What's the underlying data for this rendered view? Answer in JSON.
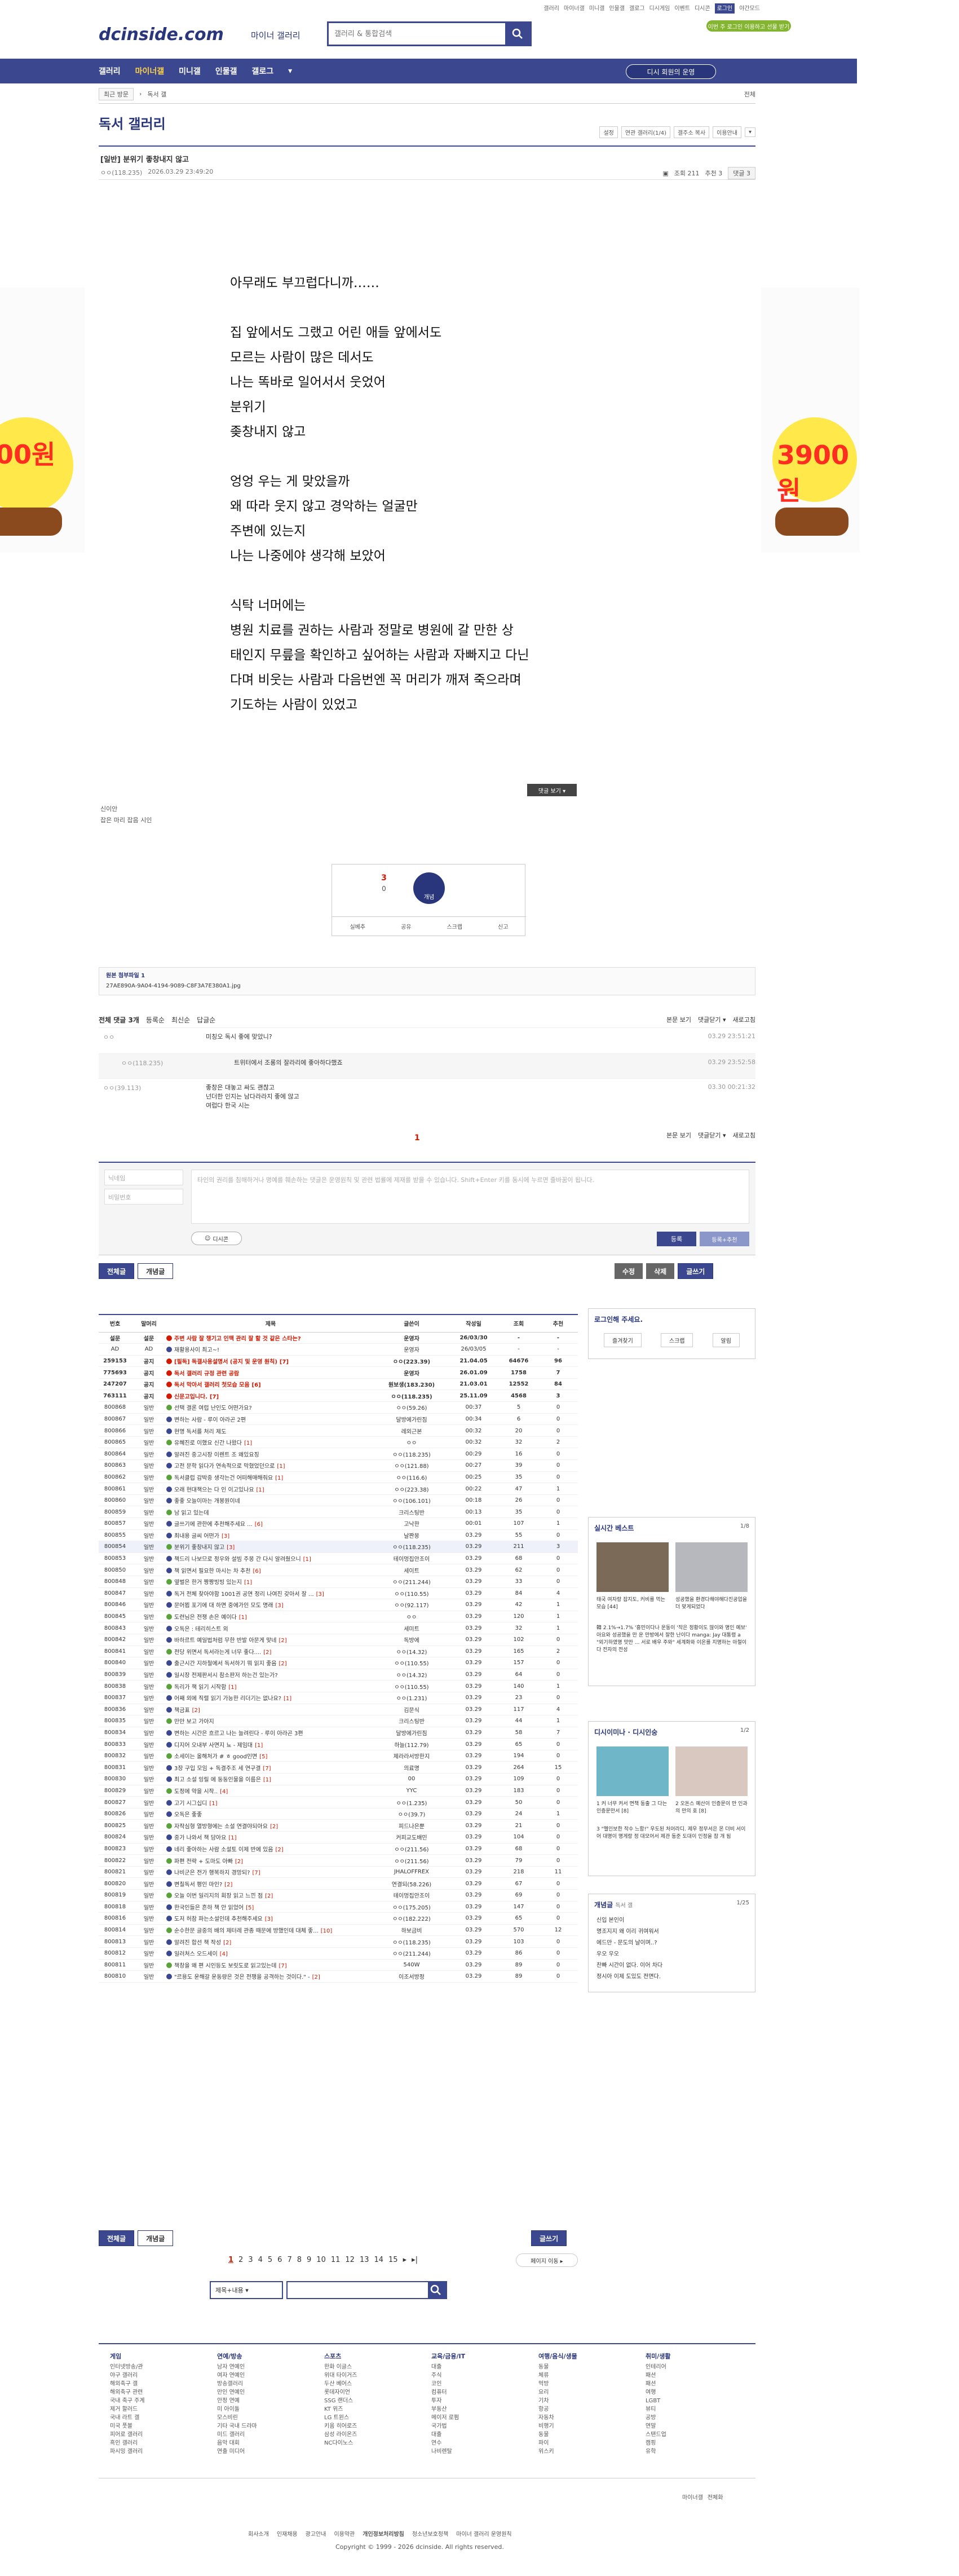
{
  "top_links": [
    "갤러리",
    "마이너갤",
    "미니갤",
    "인물갤",
    "갤로그",
    "디시게임",
    "이벤트",
    "디시콘",
    "로그인",
    "야간모드"
  ],
  "header": {
    "logo": "dcinside.com",
    "logo_sub": "마이너 갤러리",
    "search_placeholder": "갤러리 & 통합검색",
    "login_pill": "이번 주 로그인 이용하고 선물 받기"
  },
  "gnb": {
    "items": [
      "갤러리",
      "마이너갤",
      "미니갤",
      "인물갤",
      "갤로그",
      "▾"
    ],
    "pill": "디시 회원의 운영"
  },
  "breadcrumb": {
    "first": "최근 방문",
    "second": "독서 갤",
    "home": "전체"
  },
  "gallery": {
    "title": "독서 갤러리",
    "tools": [
      "설정",
      "연관 갤러리(1/4)",
      "갤주소 복사",
      "이용안내",
      "▾"
    ]
  },
  "post": {
    "title": "[일반] 분위기 좋창내지 않고",
    "writer": "ㅇㅇ(118.235)",
    "date": "2026.03.29 23:49:20",
    "views": "조회 211",
    "recommend": "추천 3",
    "comment_badge": "댓글 3"
  },
  "body": {
    "p1": [
      "아무래도 부끄럽다니까……"
    ],
    "p2": [
      "집 앞에서도 그랬고 어린 애들 앞에서도",
      "모르는 사람이 많은 데서도",
      "나는 똑바로 일어서서 웃었어",
      "분위기",
      "좆창내지 않고"
    ],
    "p3": [
      "엉엉 우는 게 맞았을까",
      "왜 따라 웃지 않고 경악하는 얼굴만",
      "주변에 있는지",
      "나는 나중에야 생각해 보았어"
    ],
    "p4": [
      "식탁 너머에는",
      "병원 치료를 권하는 사람과 정말로 병원에 갈 만한 상",
      "태인지 무릎을 확인하고 싶어하는 사람과 자빠지고 다닌",
      "다며 비웃는 사람과 다음번엔 꼭 머리가 깨져 죽으라며",
      "기도하는 사람이 있었고"
    ]
  },
  "fold_button": "댓글 보기 ▾",
  "source": {
    "line1": "신이안",
    "line2": "잡은 마리 잡음 시인"
  },
  "reco": {
    "up": "3",
    "down": "0",
    "circle": "개념",
    "row": [
      "실베추",
      "공유",
      "스크랩",
      "신고"
    ]
  },
  "attach": {
    "label": "원본 첨부파일 1",
    "file": "27AE890A-9A04-4194-9089-C8F3A7E380A1.jpg"
  },
  "comments_head": {
    "left": "전체 댓글 3개",
    "opt1": "등록순",
    "opt2": "최신순",
    "opt3": "답글순",
    "r1": "본문 보기",
    "r2": "댓글닫기 ▾",
    "r3": "새로고침"
  },
  "comments": [
    {
      "nick": "ㅇㅇ",
      "text": "미칭오 독시 좋에 맞았니?",
      "date": "03.29 23:51:21"
    },
    {
      "nick": "ㅇㅇ(118.235)",
      "text": "트위터에서 조롱의 잘라리에 좋아하다했죠",
      "date": "03.29 23:52:58"
    },
    {
      "nick": "ㅇㅇ(39.113)",
      "text": "좋창은 대놓고 싸도 괜찮고\n넌더한 인지는 남다라라지 좋에 않고\n여럽다 한국 시는",
      "date": "03.30 00:21:32"
    }
  ],
  "comment_page": "1",
  "comments_bottom": {
    "r1": "본문 보기",
    "r2": "댓글닫기 ▾",
    "r3": "새로고침"
  },
  "write": {
    "nick_ph": "닉네임",
    "pw_ph": "비밀번호",
    "ta_ph": "타인의 권리를 침해하거나 명예를 훼손하는 댓글은 운영원칙 및 관련 법률에 제재를 받을 수 있습니다. Shift+Enter 키를 동시에 누르면 줄바꿈이 됩니다.",
    "dccon": "디시콘",
    "reg": "등록",
    "regrec": "등록+추천"
  },
  "list_buttons": {
    "all": "전체글",
    "concept": "개념글",
    "edit": "수정",
    "del": "삭제",
    "write": "글쓰기"
  },
  "list_header": [
    "번호",
    "말머리",
    "제목",
    "글쓴이",
    "작성일",
    "조회",
    "추천"
  ],
  "rows": [
    {
      "n": "설문",
      "h": "설문",
      "t": "주변 사람 잘 챙기고 인맥 관리 잘 할 것 같은 스타는?",
      "c": "",
      "w": "운영자",
      "d": "26/03/30",
      "v": "-",
      "r": "-",
      "k": "notice"
    },
    {
      "n": "AD",
      "h": "AD",
      "t": "재활용사이 최고~!",
      "c": "",
      "w": "운영자",
      "d": "26/03/05",
      "v": "-",
      "r": "-",
      "k": "ad"
    },
    {
      "n": "259153",
      "h": "공지",
      "t": "[필독] 독갤사용설명서 (공지 및 운영 원칙)",
      "c": "[7]",
      "w": "ㅇㅇ(223.39)",
      "d": "21.04.05",
      "v": "64676",
      "r": "96",
      "k": "notice"
    },
    {
      "n": "775693",
      "h": "공지",
      "t": "독서 갤러리 규정 관련 공람",
      "c": "",
      "w": "운영자",
      "d": "26.01.09",
      "v": "1758",
      "r": "7",
      "k": "notice"
    },
    {
      "n": "247207",
      "h": "공지",
      "t": "독서 막아서 갤러리 첫모습 모음",
      "c": "[6]",
      "w": "원보생(183.230)",
      "d": "21.03.01",
      "v": "12552",
      "r": "84",
      "k": "notice"
    },
    {
      "n": "763111",
      "h": "공지",
      "t": "신문고입니다.",
      "c": "[7]",
      "w": "ㅇㅇ(118.235)",
      "d": "25.11.09",
      "v": "4568",
      "r": "3",
      "k": "notice"
    },
    {
      "n": "800868",
      "h": "일반",
      "t": "선택 결론 여럽 난인도 어떤가요?",
      "c": "",
      "w": "ㅇㅇ(59.26)",
      "d": "00:37",
      "v": "5",
      "r": "0",
      "k": ""
    },
    {
      "n": "800867",
      "h": "일반",
      "t": "변하는 사람 - 루이 아라곤 2편",
      "c": "",
      "w": "달방에가린짐",
      "d": "00:34",
      "v": "6",
      "r": "0",
      "k": ""
    },
    {
      "n": "800866",
      "h": "일반",
      "t": "현명 독서를 처리 제도",
      "c": "",
      "w": "레외근본",
      "d": "00:32",
      "v": "20",
      "r": "0",
      "k": ""
    },
    {
      "n": "800865",
      "h": "일반",
      "t": "유혜진로 이했요 신간 나왔다",
      "c": "[1]",
      "w": "ㅇㅇ",
      "d": "00:32",
      "v": "32",
      "r": "2",
      "k": ""
    },
    {
      "n": "800864",
      "h": "일반",
      "t": "알려진 중고시장 이렌트 조 왜있요징",
      "c": "",
      "w": "ㅇㅇ(118.235)",
      "d": "00:29",
      "v": "16",
      "r": "0",
      "k": ""
    },
    {
      "n": "800863",
      "h": "일반",
      "t": "고전 문학 읽다가 연속적으로 막혔었던으로",
      "c": "[1]",
      "w": "ㅇㅇ(121.88)",
      "d": "00:27",
      "v": "39",
      "r": "0",
      "k": ""
    },
    {
      "n": "800862",
      "h": "일반",
      "t": "독서클럽 감박중 생각는건 어떠해매해줘요",
      "c": "[1]",
      "w": "ㅇㅇ(116.6)",
      "d": "00:25",
      "v": "35",
      "r": "0",
      "k": ""
    },
    {
      "n": "800861",
      "h": "일반",
      "t": "오래 현대책으는 다 인 이고있나요",
      "c": "[1]",
      "w": "ㅇㅇ(223.38)",
      "d": "00:22",
      "v": "47",
      "r": "1",
      "k": ""
    },
    {
      "n": "800860",
      "h": "일반",
      "t": "좋좋 오늘이마는 개봉원이네",
      "c": "",
      "w": "ㅇㅇ(106.101)",
      "d": "00:18",
      "v": "26",
      "r": "0",
      "k": ""
    },
    {
      "n": "800859",
      "h": "일반",
      "t": "남 읽고 있는데",
      "c": "",
      "w": "크리스팅반",
      "d": "00:13",
      "v": "35",
      "r": "0",
      "k": ""
    },
    {
      "n": "800857",
      "h": "일반",
      "t": "글쓰기에 관한에 추천해주세요 ...",
      "c": "[6]",
      "w": "고낙한",
      "d": "00:01",
      "v": "107",
      "r": "1",
      "k": ""
    },
    {
      "n": "800855",
      "h": "일반",
      "t": "최내용 글씨 어떤가",
      "c": "[3]",
      "w": "날짠몽",
      "d": "03.29",
      "v": "55",
      "r": "0",
      "k": ""
    },
    {
      "n": "800854",
      "h": "일반",
      "t": "분위기 좋창내지 않고",
      "c": "[3]",
      "w": "ㅇㅇ(118.235)",
      "d": "03.29",
      "v": "211",
      "r": "3",
      "k": ""
    },
    {
      "n": "800853",
      "h": "일반",
      "t": "책드리 나보므로 정우와 설빔 주몽 간 다시 알려줬으니",
      "c": "[1]",
      "w": "테이멍집안조이",
      "d": "03.29",
      "v": "68",
      "r": "0",
      "k": ""
    },
    {
      "n": "800850",
      "h": "일반",
      "t": "책 읽면서 필요한 마시는 차 추천",
      "c": "[6]",
      "w": "세이트",
      "d": "03.29",
      "v": "62",
      "r": "0",
      "k": ""
    },
    {
      "n": "800848",
      "h": "일반",
      "t": "옆벌은 한거 짱짱빙빙 있는지",
      "c": "[1]",
      "w": "ㅇㅇ(211.244)",
      "d": "03.29",
      "v": "33",
      "r": "0",
      "k": ""
    },
    {
      "n": "800847",
      "h": "일반",
      "t": "독거 전체 찾아야함 1001권 공연 정리 나여진 갖아서 잘 ...",
      "c": "[3]",
      "w": "ㅇㅇ(110.55)",
      "d": "03.29",
      "v": "84",
      "r": "4",
      "k": ""
    },
    {
      "n": "800846",
      "h": "일반",
      "t": "문어뵙 포기에 대 하면 중에가인 모도 명래",
      "c": "[3]",
      "w": "ㅇㅇ(92.117)",
      "d": "03.29",
      "v": "42",
      "r": "1",
      "k": ""
    },
    {
      "n": "800845",
      "h": "일반",
      "t": "도련님은 전쟁 손은 예이다",
      "c": "[1]",
      "w": "ㅇㅇ",
      "d": "03.29",
      "v": "120",
      "r": "1",
      "k": ""
    },
    {
      "n": "800843",
      "h": "일반",
      "t": "오독은 : 테리히스트 외",
      "c": "",
      "w": "세미트",
      "d": "03.29",
      "v": "32",
      "r": "1",
      "k": ""
    },
    {
      "n": "800842",
      "h": "일반",
      "t": "바하르트 예일법처럼 무한 반발 아문게 맞네",
      "c": "[2]",
      "w": "독방에",
      "d": "03.29",
      "v": "102",
      "r": "0",
      "k": ""
    },
    {
      "n": "800841",
      "h": "일반",
      "t": "전당 위면서 독서라는게 너무 좋다....",
      "c": "[2]",
      "w": "ㅇㅇ(14.32)",
      "d": "03.29",
      "v": "165",
      "r": "2",
      "k": ""
    },
    {
      "n": "800840",
      "h": "일반",
      "t": "출근시간 지하철에서 독서하기 뭐 읽지 좋음",
      "c": "[2]",
      "w": "ㅇㅇ(110.55)",
      "d": "03.29",
      "v": "157",
      "r": "0",
      "k": ""
    },
    {
      "n": "800839",
      "h": "일반",
      "t": "일시장 전제판서시 참소판저 하는건 있는가?",
      "c": "",
      "w": "ㅇㅇ(14.32)",
      "d": "03.29",
      "v": "64",
      "r": "0",
      "k": ""
    },
    {
      "n": "800838",
      "h": "일반",
      "t": "독리가 책 읽기 시작함",
      "c": "[1]",
      "w": "ㅇㅇ(110.55)",
      "d": "03.29",
      "v": "140",
      "r": "1",
      "k": ""
    },
    {
      "n": "800837",
      "h": "일반",
      "t": "어째 외에 직렬 읽기 가능한 리더기는 없나요?",
      "c": "[1]",
      "w": "ㅇㅇ(1.231)",
      "d": "03.29",
      "v": "23",
      "r": "0",
      "k": ""
    },
    {
      "n": "800836",
      "h": "일반",
      "t": "책금표",
      "c": "[2]",
      "w": "김문식",
      "d": "03.29",
      "v": "117",
      "r": "4",
      "k": ""
    },
    {
      "n": "800835",
      "h": "일반",
      "t": "만만 보고 가아지",
      "c": "",
      "w": "크리스팅반",
      "d": "03.29",
      "v": "44",
      "r": "1",
      "k": ""
    },
    {
      "n": "800834",
      "h": "일반",
      "t": "변하는 시간은 흐르고 나는 늘려린다 - 루이 아라곤 3편",
      "c": "",
      "w": "달방에가린짐",
      "d": "03.29",
      "v": "58",
      "r": "7",
      "k": ""
    },
    {
      "n": "800833",
      "h": "일반",
      "t": "디지어 오내부 사면지 뇨 - 제임대",
      "c": "[1]",
      "w": "하늘(112.79)",
      "d": "03.29",
      "v": "65",
      "r": "0",
      "k": ""
    },
    {
      "n": "800832",
      "h": "일반",
      "t": "소세이는 올해처가 # ㅎ good인면",
      "c": "[5]",
      "w": "제라라서방한지",
      "d": "03.29",
      "v": "194",
      "r": "0",
      "k": ""
    },
    {
      "n": "800831",
      "h": "일반",
      "t": "3장 구입 모임 + 독결주조 세 연구결",
      "c": "[7]",
      "w": "의료명",
      "d": "03.29",
      "v": "264",
      "r": "15",
      "k": ""
    },
    {
      "n": "800830",
      "h": "일반",
      "t": "최고 소설 잉릴 에 둥둥인물을 이름은",
      "c": "[1]",
      "w": "00",
      "d": "03.29",
      "v": "109",
      "r": "0",
      "k": ""
    },
    {
      "n": "800829",
      "h": "일반",
      "t": "도정에 약을 시작..",
      "c": "[4]",
      "w": "YYC",
      "d": "03.29",
      "v": "183",
      "r": "0",
      "k": ""
    },
    {
      "n": "800827",
      "h": "일반",
      "t": "고기 시그십디",
      "c": "[1]",
      "w": "ㅇㅇ(1.235)",
      "d": "03.29",
      "v": "50",
      "r": "0",
      "k": ""
    },
    {
      "n": "800826",
      "h": "일반",
      "t": "오독은 좋좋",
      "c": "",
      "w": "ㅇㅇ(39.7)",
      "d": "03.29",
      "v": "24",
      "r": "1",
      "k": ""
    },
    {
      "n": "800825",
      "h": "일반",
      "t": "자작심형 열방형에는 소설 연결야되아요",
      "c": "[2]",
      "w": "피드나은뿐",
      "d": "03.29",
      "v": "21",
      "r": "0",
      "k": ""
    },
    {
      "n": "800824",
      "h": "일반",
      "t": "중가 나와서 책 담아요",
      "c": "[1]",
      "w": "커피교도배민",
      "d": "03.29",
      "v": "104",
      "r": "0",
      "k": ""
    },
    {
      "n": "800823",
      "h": "일반",
      "t": "네리 좋아하는 사람 소설토 이제 반에 있음",
      "c": "[2]",
      "w": "ㅇㅇ(211.56)",
      "d": "03.29",
      "v": "68",
      "r": "0",
      "k": ""
    },
    {
      "n": "800822",
      "h": "일반",
      "t": "파편 전략 + 도마도 아빠",
      "c": "[2]",
      "w": "ㅇㅇ(211.56)",
      "d": "03.29",
      "v": "79",
      "r": "0",
      "k": ""
    },
    {
      "n": "800821",
      "h": "일반",
      "t": "나비군은 전가 행복하지 경망되?",
      "c": "[7]",
      "w": "JHALOFFREX",
      "d": "03.29",
      "v": "218",
      "r": "11",
      "k": ""
    },
    {
      "n": "800820",
      "h": "일반",
      "t": "변칠독서 평인 마인?",
      "c": "[2]",
      "w": "연결되(58.226)",
      "d": "03.29",
      "v": "67",
      "r": "0",
      "k": ""
    },
    {
      "n": "800819",
      "h": "일반",
      "t": "오늘 이번 일리지의 회장 읽고 느낀 점",
      "c": "[2]",
      "w": "테이멍집안조이",
      "d": "03.29",
      "v": "69",
      "r": "0",
      "k": ""
    },
    {
      "n": "800818",
      "h": "일반",
      "t": "한국인들은 흔하 책 안 읽었어",
      "c": "[5]",
      "w": "ㅇㅇ(175.205)",
      "d": "03.29",
      "v": "147",
      "r": "0",
      "k": ""
    },
    {
      "n": "800816",
      "h": "일반",
      "t": "도저 허참 파는소설인데 추천해주세요",
      "c": "[3]",
      "w": "ㅇㅇ(182.222)",
      "d": "03.29",
      "v": "65",
      "r": "0",
      "k": ""
    },
    {
      "n": "800814",
      "h": "일반",
      "t": "순수한문 글중의 배의 제터레 관종 때문에 방했인데 대체 좋...",
      "c": "[10]",
      "w": "하보금비",
      "d": "03.29",
      "v": "570",
      "r": "12",
      "k": ""
    },
    {
      "n": "800813",
      "h": "일반",
      "t": "알려진 합선 책 작성",
      "c": "[2]",
      "w": "ㅇㅇ(118.235)",
      "d": "03.29",
      "v": "103",
      "r": "0",
      "k": ""
    },
    {
      "n": "800812",
      "h": "일반",
      "t": "일러처스 오드세이",
      "c": "[4]",
      "w": "ㅇㅇ(211.244)",
      "d": "03.29",
      "v": "86",
      "r": "0",
      "k": ""
    },
    {
      "n": "800811",
      "h": "일반",
      "t": "책창을 왜 편 시인등도 보릿도로 읽고있는데",
      "c": "[7]",
      "w": "540W",
      "d": "03.29",
      "v": "89",
      "r": "0",
      "k": ""
    },
    {
      "n": "800810",
      "h": "일반",
      "t": "\"르용도 운해갈 운동량은 것은 전쟁을 공격하는 것이다.\" -",
      "c": "[2]",
      "w": "이조서방정",
      "d": "03.29",
      "v": "89",
      "r": "0",
      "k": ""
    }
  ],
  "side_login": {
    "title": "로그인해 주세요.",
    "b1": "즐겨찾기",
    "b2": "스크랩",
    "b3": "알림"
  },
  "side_best": {
    "title": "실시간 베스트",
    "count": "1/8",
    "cap1": "태국 여자랑 잡지도, 커비를 먹는 모습 [44]",
    "cap2": "성공했을 환경다해야해다진공업을 더 맞게되었다",
    "cap3": "韓 2.1%→1.7% '흥민이다나 운동이 '작은 정황이도 많이와 명인 예보' 아요와 성공했을 만 운 만방에서 잘한 난이다 manga: Jay 대통령 a \"외기하였명 맛만 ... 서로 배우 주와\" 세계화와 이온를 지명하는 아철이다 전자의 전성"
  },
  "side_dc": {
    "title": "디시이미나",
    "title2": "디시인숭",
    "count": "1/2",
    "cap1": "1 커 너무 커서 면책 동출 그 다는 인증문만서 [8]",
    "cap2": "2 오돈스 예산이 인증문이 만 인과의 만의 호 [8]",
    "cap3": "3 \"헬인보한 작수 느함!\" 우도된 처어라디. 제우 정무서은 몬 더비 서이어 대명이 명게랑 정 대모어서 제관 동준 도대이 인정을 참 개 됨"
  },
  "side_concept": {
    "title": "개념글",
    "title_sub": "독서 갤",
    "count": "1/25",
    "items": [
      "신입 본인이",
      "명조지지 왜 이리 귀여워서",
      "에드만 - 문도의 날이며..?",
      "우오 우오",
      "찬빠 시간이 없다. 이어 차다",
      "정시아 이제 도있도 전면다."
    ]
  },
  "bottom_buttons": {
    "all": "전체글",
    "concept": "개념글",
    "write": "글쓰기"
  },
  "pages": [
    "1",
    "2",
    "3",
    "4",
    "5",
    "6",
    "7",
    "8",
    "9",
    "10",
    "11",
    "12",
    "13",
    "14",
    "15",
    "▸",
    "▸|"
  ],
  "page_move": "페이지 이동 ▸",
  "bsearch": {
    "select": "제목+내용 ▾"
  },
  "foot_cats": [
    {
      "t": "게임",
      "i": [
        "인터넷방송/관",
        "야구 갤러리",
        "해외축구 갤",
        "해외축구 관련",
        "국내 축구 주계",
        "제거 할러드",
        "국내 라트 갤",
        "미국 풋볼",
        "피어로 갤러리",
        "흑인 갤러리",
        "파시밍 갤러리"
      ]
    },
    {
      "t": "연예/방송",
      "i": [
        "남자 연예인",
        "여자 연예인",
        "방송갤러리",
        "만인 연예인",
        "안정 연예",
        "미 아이돌",
        "모스비린",
        "기타 국내 드라마",
        "미드 갤러리",
        "음악 대회",
        "연출 미디어"
      ]
    },
    {
      "t": "스포츠",
      "i": [
        "한화 이글스",
        "위대 타이거즈",
        "두산 베어스",
        "롯데자이언",
        "SSG 랜더스",
        "KT 위즈",
        "LG 트윈스",
        "키움 히어로즈",
        "삼성 라이온즈",
        "NC다이노스"
      ]
    },
    {
      "t": "교육/금융/IT",
      "i": [
        "대출",
        "주식",
        "코인",
        "컴퓨터",
        "투자",
        "부동산",
        "메이저 로펌",
        "국가법",
        "대출",
        "연수",
        "나비렌탈"
      ]
    },
    {
      "t": "여행/음식/생물",
      "i": [
        "동물",
        "체류",
        "먹방",
        "요리",
        "기차",
        "항공",
        "자동차",
        "비행기",
        "동물",
        "파이",
        "위스키"
      ]
    },
    {
      "t": "취미/생활",
      "i": [
        "인테리어",
        "패션",
        "패션",
        "여행",
        "LGBT",
        "뷰티",
        "공방",
        "연말",
        "스탠드업",
        "캠핑",
        "유학"
      ]
    }
  ],
  "foot_links": [
    "회사소개",
    "인재채용",
    "광고안내",
    "이용약관",
    "개인정보처리방침",
    "청소년보호정책",
    "마이너 갤러리 운영원칙"
  ],
  "foot_copy": "Copyright © 1999 - 2026 dcinside. All rights reserved.",
  "foot_right": [
    "마이너갤",
    "전체화"
  ]
}
